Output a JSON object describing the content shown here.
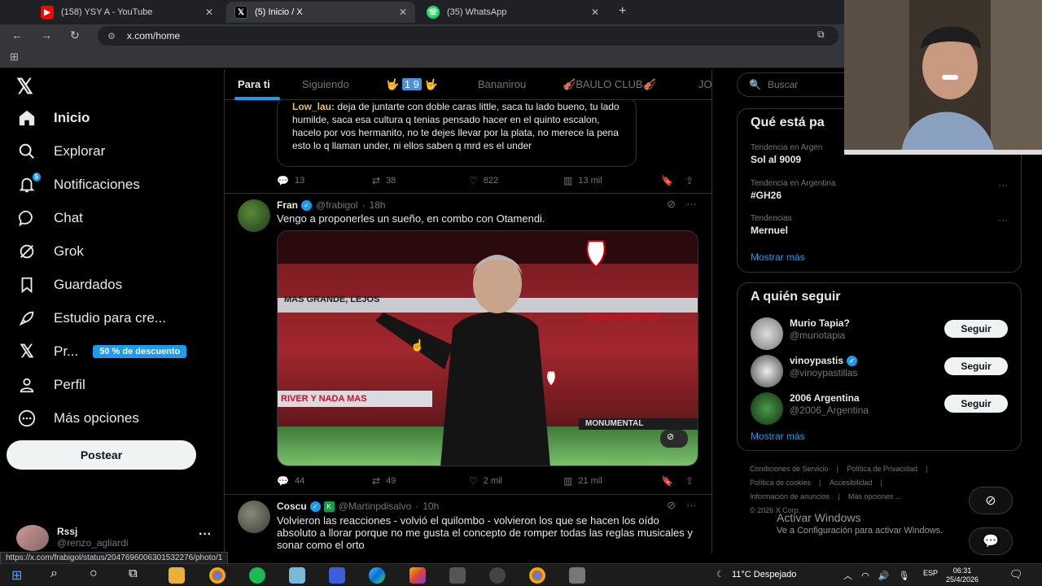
{
  "browser": {
    "tabs": [
      {
        "label": "(158) YSY A - YouTube",
        "icon": "youtube-icon"
      },
      {
        "label": "(5) Inicio / X",
        "icon": "x-icon"
      },
      {
        "label": "(35) WhatsApp",
        "icon": "whatsapp-icon"
      }
    ],
    "url": "x.com/home",
    "status_url": "https://x.com/frabigol/status/2047696006301532276/photo/1"
  },
  "sidebar": {
    "items": [
      {
        "label": "Inicio",
        "icon": "home-icon"
      },
      {
        "label": "Explorar",
        "icon": "search-icon"
      },
      {
        "label": "Notificaciones",
        "icon": "bell-icon",
        "badge": "5"
      },
      {
        "label": "Chat",
        "icon": "chat-icon"
      },
      {
        "label": "Grok",
        "icon": "grok-icon"
      },
      {
        "label": "Guardados",
        "icon": "bookmark-icon"
      },
      {
        "label": "Estudio para cre...",
        "icon": "rocket-icon"
      },
      {
        "label": "Pr...",
        "icon": "x-premium-icon",
        "promo": "50 % de descuento"
      },
      {
        "label": "Perfil",
        "icon": "person-icon"
      },
      {
        "label": "Más opciones",
        "icon": "more-circle-icon"
      }
    ],
    "post_label": "Postear",
    "account": {
      "name": "Rssj",
      "handle": "@renzo_agliardi"
    }
  },
  "feed": {
    "tabs": [
      "Para ti",
      "Siguiendo",
      "1 9",
      "Bananirou",
      "BAULO CLUB",
      "JO"
    ],
    "quote": {
      "name": "Low_lau:",
      "text": "deja de juntarte con doble caras little, saca tu lado bueno, tu lado humilde, saca esa cultura q tenias pensado hacer en el quinto escalon, hacelo por vos hermanito, no te dejes llevar por la plata, no merece la pena esto lo q llaman under, ni ellos saben q mrd es el under"
    },
    "tweet1_actions": {
      "replies": "13",
      "reposts": "38",
      "likes": "822",
      "views": "13 mil"
    },
    "tweet2": {
      "name": "Fran",
      "handle": "@frabigol",
      "time": "18h",
      "text": "Vengo a proponerles un sueño, en combo con Otamendi.",
      "actions": {
        "replies": "44",
        "reposts": "49",
        "likes": "2 mil",
        "views": "21 mil"
      },
      "banner1": "MAS GRANDE, LEJOS",
      "banner2": "PRIMERO RIVER",
      "banner3": "RIVER Y NADA MAS",
      "banner4": "MONUMENTAL"
    },
    "tweet3": {
      "name": "Coscu",
      "handle": "@Martinpdisalvo",
      "time": "10h",
      "text": "Volvieron las reacciones - volvió el quilombo - volvieron los que se hacen los oído absoluto a llorar porque no me gusta el concepto de romper todas las reglas musicales y sonar como el orto"
    }
  },
  "right": {
    "search_placeholder": "Buscar",
    "trends_title": "Qué está pa",
    "trends": [
      {
        "context": "Tendencia en Argen",
        "name": "Sol al 9009"
      },
      {
        "context": "Tendencia en Argentina",
        "name": "#GH26"
      },
      {
        "context": "Tendencias",
        "name": "Mernuel"
      }
    ],
    "show_more": "Mostrar más",
    "follow_title": "A quién seguir",
    "follow": [
      {
        "name": "Murio Tapia?",
        "handle": "@muriotapia",
        "verified": false
      },
      {
        "name": "vinoypastis",
        "handle": "@vinoypastillas",
        "verified": true
      },
      {
        "name": "2006 Argentina",
        "handle": "@2006_Argentina",
        "verified": false
      }
    ],
    "follow_btn": "Seguir",
    "footer": [
      "Condiciones de Servicio",
      "Política de Privacidad",
      "Política de cookies",
      "Accesibilidad",
      "Información de anuncios",
      "Más opciones ...",
      "© 2026 X Corp."
    ],
    "activate_title": "Activar Windows",
    "activate_sub": "Ve a Configuración para activar Windows."
  },
  "taskbar": {
    "weather": "11°C  Despejado",
    "lang": "ESP",
    "time": "06:31",
    "date": "25/4/2026"
  },
  "colors": {
    "accent": "#1d9bf0",
    "background": "#000000",
    "border": "#2f3336"
  }
}
